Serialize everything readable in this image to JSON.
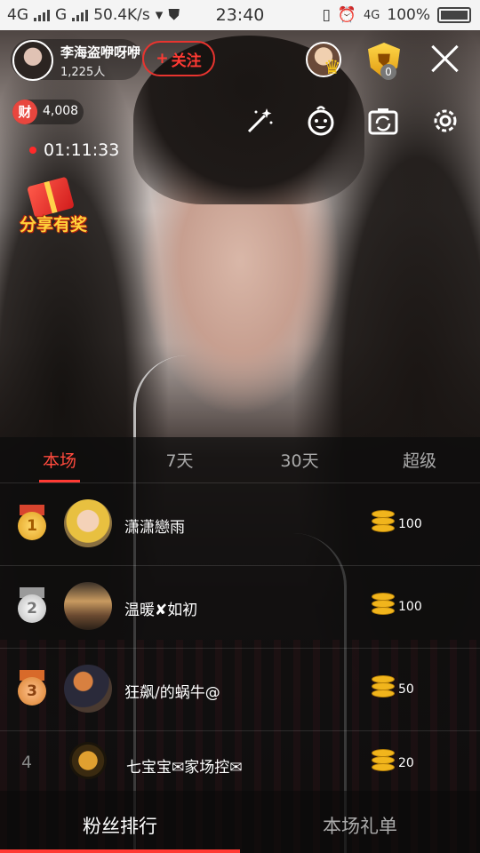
{
  "status_bar": {
    "network1": "4G",
    "network2": "G",
    "speed": "50.4K/s",
    "time": "23:40",
    "network3": "4G",
    "battery": "100%"
  },
  "host": {
    "name": "李海盗咿呀咿",
    "followers": "1,225人",
    "follow_label": "关注"
  },
  "shield_count": "0",
  "wealth": {
    "icon_text": "财",
    "value": "4,008"
  },
  "live_time": "01:11:33",
  "share_reward": "分享有奖",
  "ranking": {
    "tabs": [
      "本场",
      "7天",
      "30天",
      "超级"
    ],
    "active_tab": "本场",
    "rows": [
      {
        "rank": "1",
        "name": "潇潇戀雨",
        "value": "100"
      },
      {
        "rank": "2",
        "name": "温暖✘如初",
        "value": "100"
      },
      {
        "rank": "3",
        "name": "狂飙/的蜗牛@",
        "value": "50"
      },
      {
        "rank": "4",
        "name": "七宝宝✉家场控✉",
        "value": "20"
      }
    ]
  },
  "bottom_tabs": {
    "fans": "粉丝排行",
    "gifts": "本场礼单"
  },
  "colors": {
    "accent": "#ff3a33",
    "coin": "#f1b51c"
  }
}
